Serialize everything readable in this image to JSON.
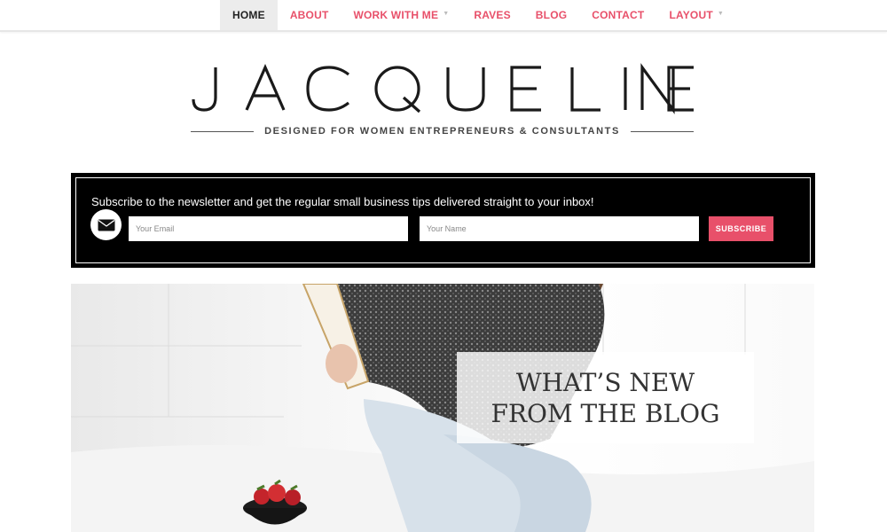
{
  "nav": {
    "items": [
      {
        "label": "HOME",
        "active": true,
        "dropdown": false
      },
      {
        "label": "ABOUT",
        "active": false,
        "dropdown": false
      },
      {
        "label": "WORK WITH ME",
        "active": false,
        "dropdown": true
      },
      {
        "label": "RAVES",
        "active": false,
        "dropdown": false
      },
      {
        "label": "BLOG",
        "active": false,
        "dropdown": false
      },
      {
        "label": "CONTACT",
        "active": false,
        "dropdown": false
      },
      {
        "label": "LAYOUT",
        "active": false,
        "dropdown": true
      }
    ],
    "caret_icon": "chevron-down-icon",
    "accent_color": "#e8506a"
  },
  "brand": {
    "logo_text": "JACQUELINE",
    "tagline": "DESIGNED FOR WOMEN ENTREPRENEURS & CONSULTANTS"
  },
  "newsletter": {
    "text": "Subscribe to the newsletter and get the regular small business tips delivered straight to your inbox!",
    "icon": "envelope-icon",
    "email_placeholder": "Your Email",
    "name_placeholder": "Your Name",
    "button_label": "SUBSCRIBE",
    "button_color": "#e8506a"
  },
  "hero": {
    "title": "WHAT’S NEW FROM THE BLOG"
  }
}
